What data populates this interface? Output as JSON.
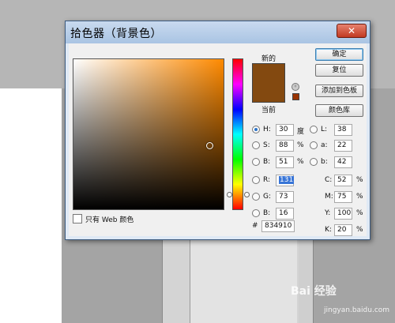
{
  "window": {
    "title": "拾色器（背景色）",
    "close_label": "✕"
  },
  "swatch": {
    "new_label": "新的",
    "current_label": "当前",
    "new_color": "#834910",
    "current_color": "#834910",
    "warning_icon": "cube-warning-icon",
    "websafe_color": "#993300"
  },
  "buttons": {
    "ok": "确定",
    "reset": "复位",
    "add_to_swatches": "添加到色板",
    "color_libraries": "颜色库"
  },
  "only_web_colors_label": "只有 Web 颜色",
  "fields": {
    "H": {
      "label": "H:",
      "value": "30",
      "unit": "度"
    },
    "S": {
      "label": "S:",
      "value": "88",
      "unit": "%"
    },
    "Bv": {
      "label": "B:",
      "value": "51",
      "unit": "%"
    },
    "R": {
      "label": "R:",
      "value": "131"
    },
    "G": {
      "label": "G:",
      "value": "73"
    },
    "Bc": {
      "label": "B:",
      "value": "16"
    },
    "L": {
      "label": "L:",
      "value": "38"
    },
    "a": {
      "label": "a:",
      "value": "22"
    },
    "b": {
      "label": "b:",
      "value": "42"
    },
    "C": {
      "label": "C:",
      "value": "52",
      "unit": "%"
    },
    "M": {
      "label": "M:",
      "value": "75",
      "unit": "%"
    },
    "Y": {
      "label": "Y:",
      "value": "100",
      "unit": "%"
    },
    "K": {
      "label": "K:",
      "value": "20",
      "unit": "%"
    }
  },
  "hex": {
    "label": "#",
    "value": "834910"
  },
  "watermark": {
    "text": "Bai 经验",
    "sub": "jingyan.baidu.com"
  },
  "colors": {
    "accent": "#2a73c9",
    "field_base": "#ff8a00"
  }
}
